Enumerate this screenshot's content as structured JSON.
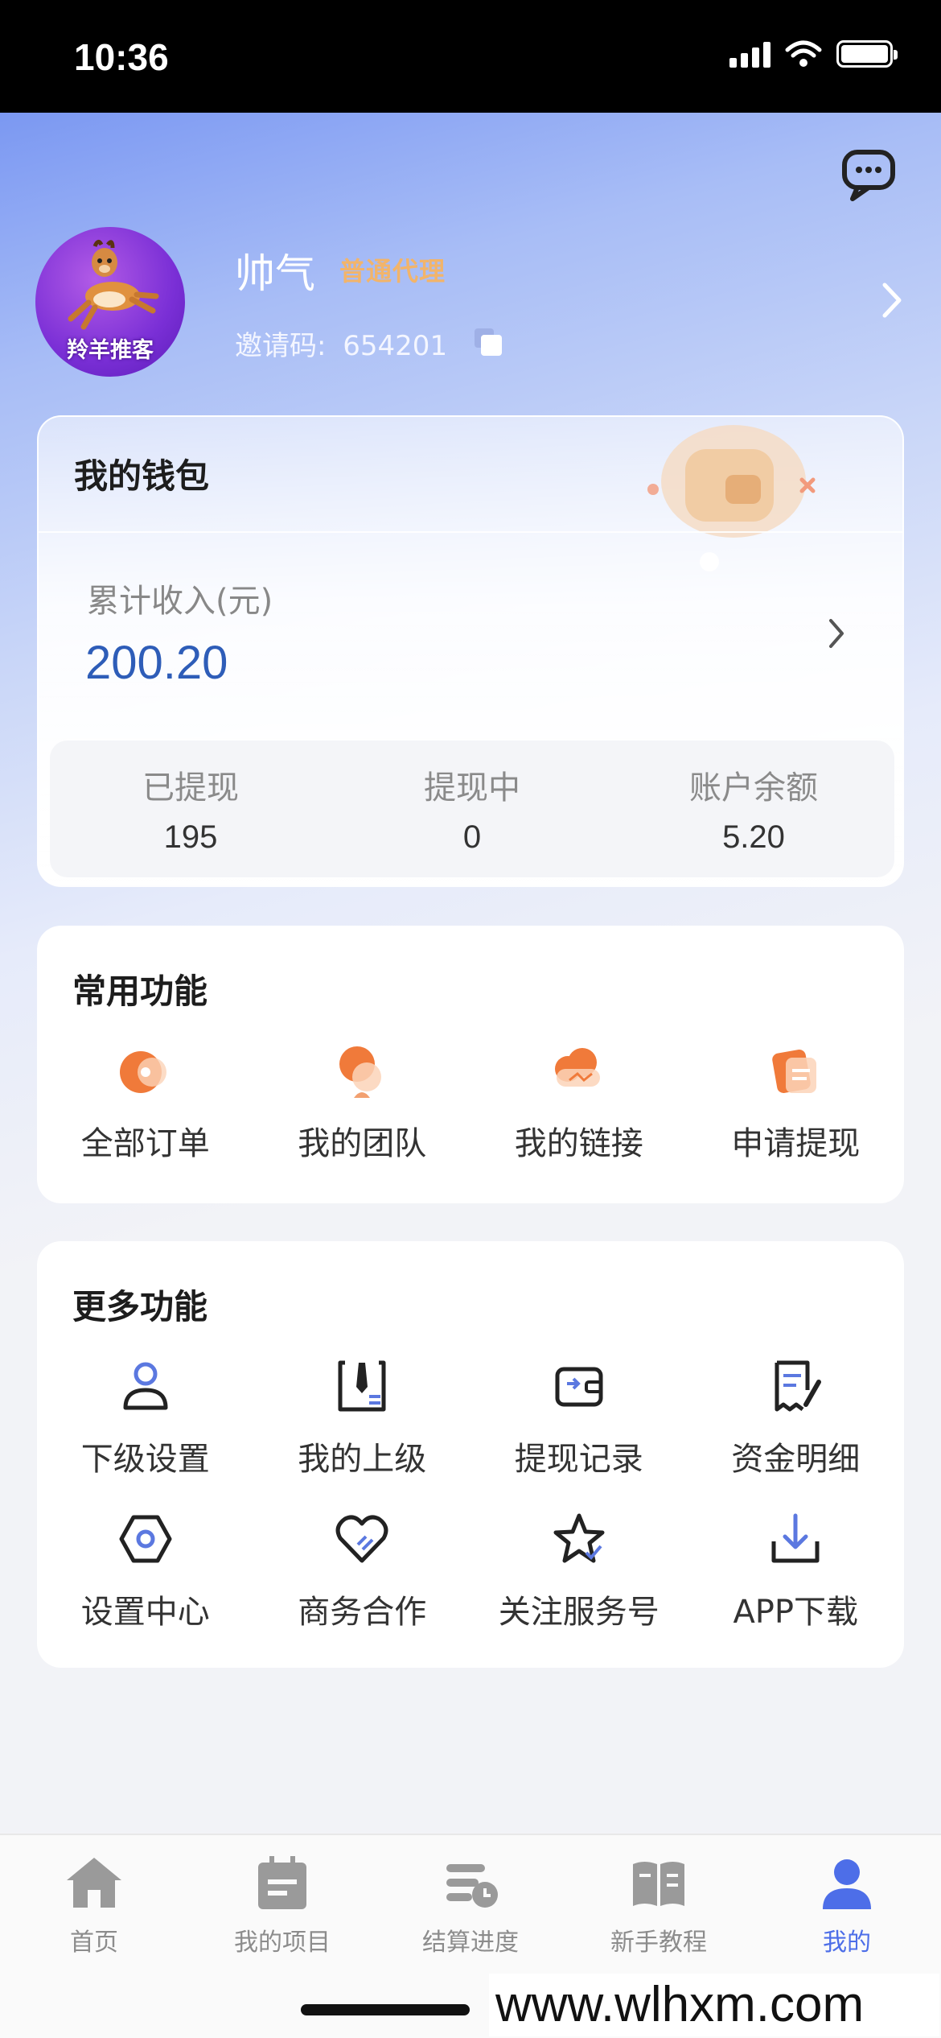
{
  "status": {
    "time": "10:36"
  },
  "profile": {
    "name": "帅气",
    "level": "普通代理",
    "invite_label": "邀请码:",
    "invite_code": "654201",
    "avatar_text": "羚羊推客"
  },
  "wallet": {
    "title": "我的钱包",
    "income_label": "累计收入(元)",
    "income_value": "200.20",
    "stats": [
      {
        "label": "已提现",
        "value": "195"
      },
      {
        "label": "提现中",
        "value": "0"
      },
      {
        "label": "账户余额",
        "value": "5.20"
      }
    ]
  },
  "common": {
    "title": "常用功能",
    "items": [
      {
        "label": "全部订单",
        "icon": "orders-icon"
      },
      {
        "label": "我的团队",
        "icon": "team-icon"
      },
      {
        "label": "我的链接",
        "icon": "link-cloud-icon"
      },
      {
        "label": "申请提现",
        "icon": "withdraw-apply-icon"
      }
    ]
  },
  "more": {
    "title": "更多功能",
    "items": [
      {
        "label": "下级设置",
        "icon": "user-icon"
      },
      {
        "label": "我的上级",
        "icon": "tie-icon"
      },
      {
        "label": "提现记录",
        "icon": "wallet-icon"
      },
      {
        "label": "资金明细",
        "icon": "receipt-icon"
      },
      {
        "label": "设置中心",
        "icon": "hex-settings-icon"
      },
      {
        "label": "商务合作",
        "icon": "heart-handshake-icon"
      },
      {
        "label": "关注服务号",
        "icon": "star-check-icon"
      },
      {
        "label": "APP下载",
        "icon": "download-icon"
      }
    ]
  },
  "tabbar": {
    "items": [
      {
        "label": "首页",
        "icon": "home-icon"
      },
      {
        "label": "我的项目",
        "icon": "project-icon"
      },
      {
        "label": "结算进度",
        "icon": "settlement-icon"
      },
      {
        "label": "新手教程",
        "icon": "book-icon"
      },
      {
        "label": "我的",
        "icon": "profile-icon"
      }
    ],
    "active_index": 4
  },
  "watermark": "www.wlhxm.com",
  "colors": {
    "accent": "#4d6ee8",
    "income": "#2e5db8",
    "level": "#f2b46a",
    "orange": "#f07a3a"
  }
}
